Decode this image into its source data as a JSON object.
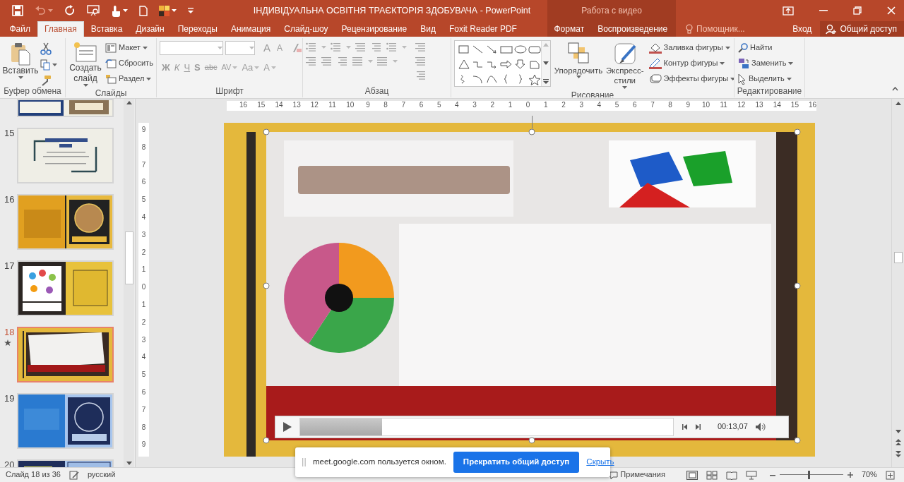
{
  "title_bar": {
    "title": "ІНДИВІДУАЛЬНА ОСВІТНЯ ТРАЄКТОРІЯ ЗДОБУВАЧА - PowerPoint",
    "context_group": "Работа с видео"
  },
  "tabs": [
    {
      "label": "Файл",
      "kind": "file",
      "selected": false
    },
    {
      "label": "Главная",
      "kind": "main",
      "selected": true
    },
    {
      "label": "Вставка",
      "kind": "main",
      "selected": false
    },
    {
      "label": "Дизайн",
      "kind": "main",
      "selected": false
    },
    {
      "label": "Переходы",
      "kind": "main",
      "selected": false
    },
    {
      "label": "Анимация",
      "kind": "main",
      "selected": false
    },
    {
      "label": "Слайд-шоу",
      "kind": "main",
      "selected": false
    },
    {
      "label": "Рецензирование",
      "kind": "main",
      "selected": false
    },
    {
      "label": "Вид",
      "kind": "main",
      "selected": false
    },
    {
      "label": "Foxit Reader PDF",
      "kind": "main",
      "selected": false
    },
    {
      "label": "Формат",
      "kind": "context",
      "selected": false
    },
    {
      "label": "Воспроизведение",
      "kind": "context",
      "selected": false
    }
  ],
  "tell_me": {
    "placeholder": "Помощник..."
  },
  "account": {
    "sign_in": "Вход",
    "share": "Общий доступ"
  },
  "ribbon": {
    "clipboard": {
      "label": "Буфер обмена",
      "paste": "Вставить"
    },
    "slides": {
      "label": "Слайды",
      "new_slide": "Создать слайд",
      "commands": [
        "Макет",
        "Сбросить",
        "Раздел"
      ]
    },
    "font": {
      "label": "Шрифт",
      "disabled": true,
      "size_buttons": [
        "A",
        "A"
      ],
      "formats": [
        "Ж",
        "К",
        "Ч",
        "S",
        "abc",
        "AV",
        "Aa",
        "A"
      ]
    },
    "paragraph": {
      "label": "Абзац",
      "disabled": true
    },
    "drawing": {
      "label": "Рисование",
      "arrange": "Упорядочить",
      "quick_styles": "Экспресс-стили",
      "commands": [
        "Заливка фигуры",
        "Контур фигуры",
        "Эффекты фигуры"
      ]
    },
    "editing": {
      "label": "Редактирование",
      "commands": [
        "Найти",
        "Заменить",
        "Выделить"
      ]
    }
  },
  "thumbnails": [
    {
      "kind": "frame_partial",
      "selected": false,
      "starred": false
    },
    {
      "number": "15",
      "kind": "title_block",
      "selected": false,
      "starred": false
    },
    {
      "number": "16",
      "kind": "gold_portrait",
      "selected": false,
      "starred": false
    },
    {
      "number": "17",
      "kind": "dark_bubbles",
      "selected": false,
      "starred": false
    },
    {
      "number": "18",
      "kind": "video",
      "selected": true,
      "starred": true
    },
    {
      "number": "19",
      "kind": "blue_circle",
      "selected": false,
      "starred": false
    },
    {
      "number": "20",
      "kind": "blue_partial",
      "selected": false,
      "starred": false
    }
  ],
  "rulers": {
    "horizontal": [
      "16",
      "15",
      "14",
      "13",
      "12",
      "11",
      "10",
      "9",
      "8",
      "7",
      "6",
      "5",
      "4",
      "3",
      "2",
      "1",
      "0",
      "1",
      "2",
      "3",
      "4",
      "5",
      "6",
      "7",
      "8",
      "9",
      "10",
      "11",
      "12",
      "13",
      "14",
      "15",
      "16"
    ],
    "vertical": [
      "9",
      "8",
      "7",
      "6",
      "5",
      "4",
      "3",
      "2",
      "1",
      "0",
      "1",
      "2",
      "3",
      "4",
      "5",
      "6",
      "7",
      "8",
      "9"
    ]
  },
  "video": {
    "kind": "picture",
    "level": 0.22,
    "time": "00:13,07"
  },
  "share_bar": {
    "message": "meet.google.com пользуется окном.",
    "stop_button": "Прекратить общий доступ",
    "hide_link": "Скрыть"
  },
  "status_bar": {
    "slide": "Слайд 18 из 36",
    "language": "русский",
    "comments": "Примечания",
    "zoom": "70%",
    "zoom_slider": {
      "level": 0.45
    }
  }
}
